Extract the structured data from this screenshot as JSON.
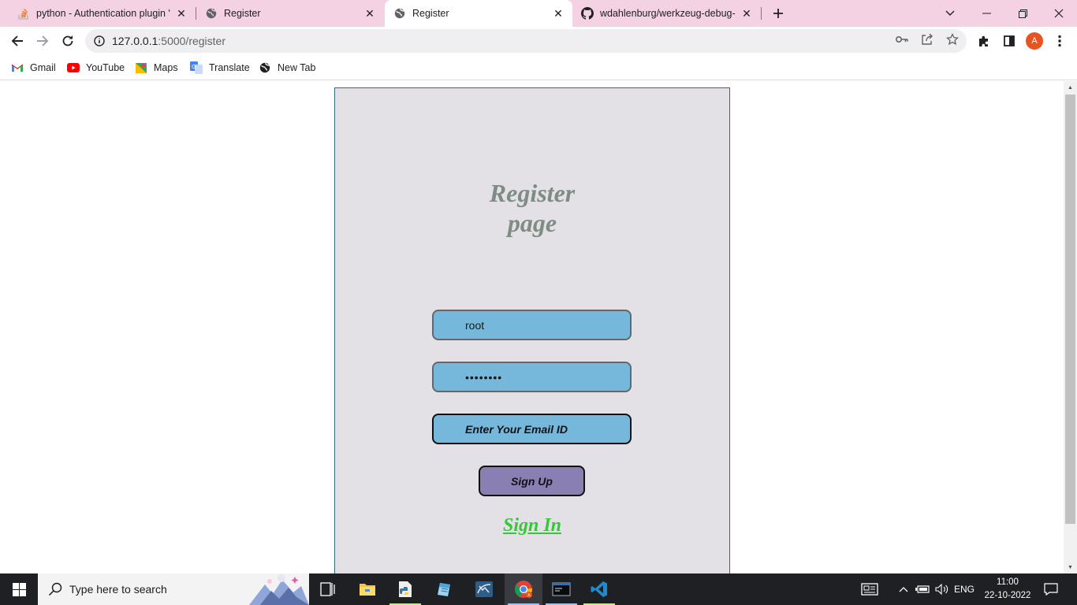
{
  "browser": {
    "tabs": [
      {
        "title": "python - Authentication plugin 'c",
        "icon": "stackoverflow-icon",
        "active": false
      },
      {
        "title": "Register",
        "icon": "globe-icon",
        "active": false
      },
      {
        "title": "Register",
        "icon": "globe-icon",
        "active": true
      },
      {
        "title": "wdahlenburg/werkzeug-debug-c",
        "icon": "github-icon",
        "active": false
      }
    ],
    "url_host": "127.0.0.1",
    "url_rest": ":5000/register",
    "avatar_letter": "A"
  },
  "bookmarks": [
    {
      "label": "Gmail",
      "icon": "gmail-icon"
    },
    {
      "label": "YouTube",
      "icon": "youtube-icon"
    },
    {
      "label": "Maps",
      "icon": "maps-icon"
    },
    {
      "label": "Translate",
      "icon": "translate-icon"
    },
    {
      "label": "New Tab",
      "icon": "globe-icon"
    }
  ],
  "page": {
    "title_line1": "Register",
    "title_line2": "page",
    "username_value": "root",
    "password_value": "••••••••",
    "email_placeholder": "Enter Your Email ID",
    "signup_label": "Sign Up",
    "signin_label": "Sign In"
  },
  "taskbar": {
    "search_placeholder": "Type here to search",
    "language": "ENG",
    "time": "11:00",
    "date": "22-10-2022"
  },
  "colors": {
    "tabstrip_bg": "#f4d1e3",
    "card_bg": "#e3e0e6",
    "input_bg": "#75b8db",
    "signup_bg": "#8a7fb2",
    "signin_color": "#33c933",
    "title_color": "#7e8c84"
  }
}
